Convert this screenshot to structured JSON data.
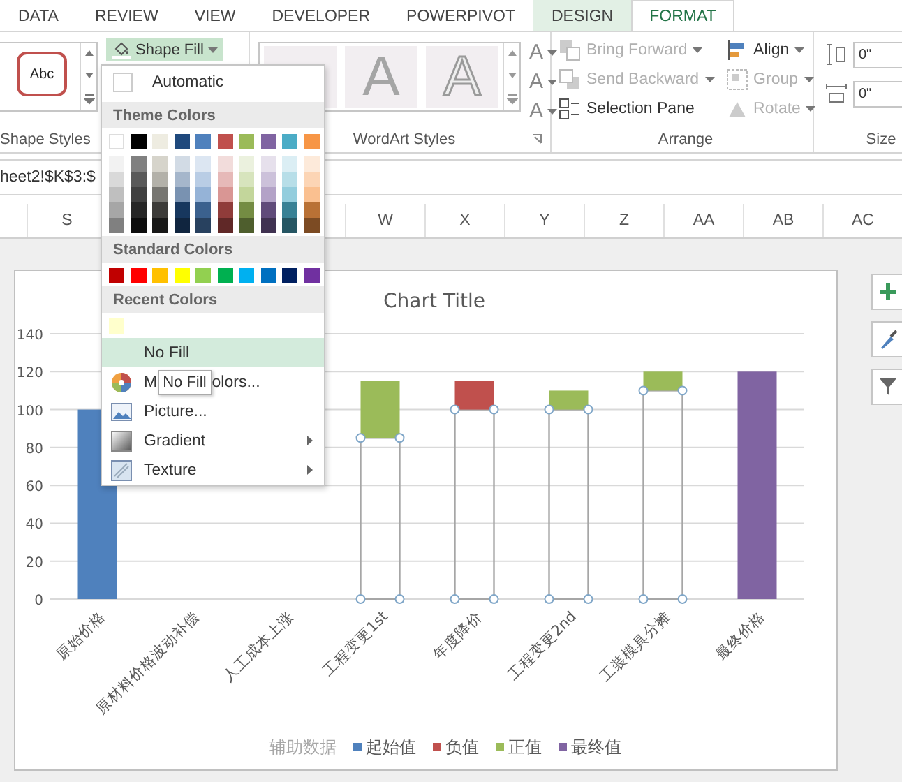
{
  "ribbon_tabs": [
    {
      "label": "DATA",
      "selected": false,
      "contextual": false
    },
    {
      "label": "REVIEW",
      "selected": false,
      "contextual": false
    },
    {
      "label": "VIEW",
      "selected": false,
      "contextual": false
    },
    {
      "label": "DEVELOPER",
      "selected": false,
      "contextual": false
    },
    {
      "label": "POWERPIVOT",
      "selected": false,
      "contextual": false
    },
    {
      "label": "DESIGN",
      "selected": false,
      "contextual": true
    },
    {
      "label": "FORMAT",
      "selected": true,
      "contextual": true
    }
  ],
  "ribbon": {
    "shape_styles": {
      "preview": "Abc",
      "fill_button": "Shape Fill",
      "label": "Shape Styles"
    },
    "wordart_styles": {
      "tiles": [
        {
          "text": "A",
          "kind": "filled"
        },
        {
          "text": "A",
          "kind": "outlined"
        }
      ],
      "text_buttons": [
        "A",
        "A",
        "A"
      ],
      "label": "WordArt Styles"
    },
    "arrange": {
      "label": "Arrange",
      "commands": [
        {
          "kind": "bring_forward",
          "label": "Bring Forward",
          "disabled": true,
          "dropdown": true
        },
        {
          "kind": "send_backward",
          "label": "Send Backward",
          "disabled": true,
          "dropdown": true
        },
        {
          "kind": "selection_pane",
          "label": "Selection Pane",
          "disabled": false,
          "dropdown": false
        },
        {
          "kind": "align",
          "label": "Align",
          "disabled": false,
          "dropdown": true
        },
        {
          "kind": "group",
          "label": "Group",
          "disabled": true,
          "dropdown": true
        },
        {
          "kind": "rotate",
          "label": "Rotate",
          "disabled": true,
          "dropdown": true
        }
      ]
    },
    "size": {
      "label": "Size",
      "fields": [
        {
          "kind": "height",
          "value": "0\""
        },
        {
          "kind": "width",
          "value": "0\""
        }
      ]
    }
  },
  "formula_bar": {
    "value": "heet2!$K$3:$"
  },
  "column_headers": [
    "S",
    "W",
    "X",
    "Y",
    "Z",
    "AA",
    "AB",
    "AC"
  ],
  "fill_menu": {
    "automatic": "Automatic",
    "theme_colors": {
      "heading": "Theme Colors",
      "swatches": [
        {
          "color": "#ffffff",
          "kind": "light"
        },
        {
          "color": "#000000",
          "kind": "dark"
        },
        {
          "color": "#eeece1",
          "kind": "tan"
        },
        {
          "color": "#1f497d",
          "kind": "normal"
        },
        {
          "color": "#4f81bd",
          "kind": "normal"
        },
        {
          "color": "#c0504d",
          "kind": "normal"
        },
        {
          "color": "#9bbb59",
          "kind": "normal"
        },
        {
          "color": "#8064a2",
          "kind": "normal"
        },
        {
          "color": "#4bacc6",
          "kind": "normal"
        },
        {
          "color": "#f79646",
          "kind": "normal"
        }
      ]
    },
    "standard_colors": {
      "heading": "Standard Colors",
      "swatches": [
        {
          "color": "#c00000"
        },
        {
          "color": "#ff0000"
        },
        {
          "color": "#ffc000"
        },
        {
          "color": "#ffff00"
        },
        {
          "color": "#92d050"
        },
        {
          "color": "#00b050"
        },
        {
          "color": "#00b0f0"
        },
        {
          "color": "#0070c0"
        },
        {
          "color": "#002060"
        },
        {
          "color": "#7030a0"
        }
      ]
    },
    "recent_colors": {
      "heading": "Recent Colors",
      "swatches": [
        {
          "color": "#ffffcc"
        }
      ]
    },
    "items": [
      {
        "kind": "no_fill",
        "label": "No Fill",
        "selected": true
      },
      {
        "kind": "more_colors",
        "label_start": "M",
        "tooltip": "No Fill",
        "label_end": "olors...",
        "selected": false
      },
      {
        "kind": "picture",
        "label": "Picture...",
        "selected": false
      },
      {
        "kind": "gradient",
        "label": "Gradient",
        "submenu": true,
        "selected": false
      },
      {
        "kind": "texture",
        "label": "Texture",
        "submenu": true,
        "selected": false
      }
    ]
  },
  "chart": {
    "chart_data": {
      "type": "bar",
      "title": "Chart Title",
      "stacked": true,
      "grid": true,
      "legend": true,
      "categories": [
        "原始价格",
        "原材料价格波动补偿",
        "人工成本上涨",
        "工程变更1st",
        "年度降价",
        "工程变更2nd",
        "工装模具分摊",
        "最终价格"
      ],
      "ylim": [
        0,
        140
      ],
      "yticks": [
        0,
        20,
        40,
        60,
        80,
        100,
        120,
        140
      ],
      "series": [
        {
          "name": "辅助数据",
          "color": "#a6a6a6",
          "values": [
            null,
            null,
            null,
            85,
            100,
            100,
            110,
            null
          ]
        },
        {
          "name": "起始值",
          "color": "#4f81bd",
          "values": [
            100,
            null,
            null,
            null,
            null,
            null,
            null,
            null
          ]
        },
        {
          "name": "负值",
          "color": "#c0504d",
          "values": [
            null,
            null,
            null,
            null,
            15,
            null,
            null,
            null
          ]
        },
        {
          "name": "正值",
          "color": "#9bbb59",
          "values": [
            null,
            null,
            null,
            30,
            null,
            10,
            10,
            null
          ]
        },
        {
          "name": "最终值",
          "color": "#8064a2",
          "values": [
            null,
            null,
            null,
            null,
            null,
            null,
            null,
            120
          ]
        }
      ]
    }
  }
}
